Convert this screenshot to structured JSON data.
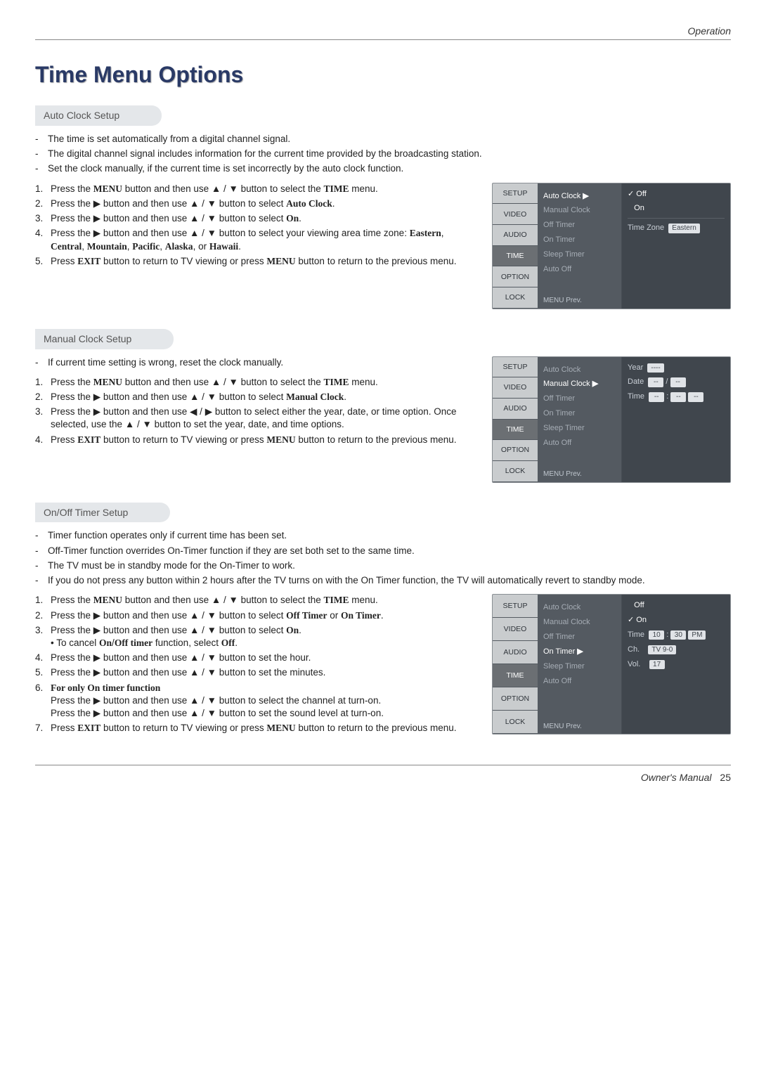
{
  "header_label": "Operation",
  "page_title": "Time Menu Options",
  "footer_label": "Owner's Manual",
  "footer_page": "25",
  "osd_tabs": [
    "SETUP",
    "VIDEO",
    "AUDIO",
    "TIME",
    "OPTION",
    "LOCK"
  ],
  "osd_menu_items": [
    "Auto Clock",
    "Manual Clock",
    "Off Timer",
    "On Timer",
    "Sleep Timer",
    "Auto Off"
  ],
  "osd_prev_hint": "MENU Prev.",
  "auto": {
    "title": "Auto Clock Setup",
    "notes": [
      "The time is set automatically from a digital channel signal.",
      "The digital channel signal includes information for the current time provided by the broadcasting station.",
      "Set the clock manually, if the current time is set incorrectly by the auto clock function."
    ],
    "steps": [
      "Press the <b class='strong'>MENU</b> button and then use <span class='arrow'>▲</span> / <span class='arrow'>▼</span> button to select the <b class='strong'>TIME</b> menu.",
      "Press the <span class='arrow'>▶</span> button and then use <span class='arrow'>▲</span> / <span class='arrow'>▼</span> button to select <b class='strong'>Auto Clock</b>.",
      "Press the <span class='arrow'>▶</span> button and then use <span class='arrow'>▲</span> / <span class='arrow'>▼</span> button to select <b class='strong'>On</b>.",
      "Press the <span class='arrow'>▶</span> button and then use <span class='arrow'>▲</span> / <span class='arrow'>▼</span> button to select your viewing area time zone: <b class='strong'>Eastern</b>, <b class='strong'>Central</b>, <b class='strong'>Mountain</b>, <b class='strong'>Pacific</b>, <b class='strong'>Alaska</b>, or <b class='strong'>Hawaii</b>.",
      "Press <b class='strong'>EXIT</b> button to return to TV viewing or press <b class='strong'>MENU</b> button to return to the previous menu."
    ],
    "osd_right": {
      "l1_tick": "✓",
      "l1_val": "Off",
      "l2_val": "On",
      "l3_label": "Time Zone",
      "l3_val": "Eastern"
    }
  },
  "manual": {
    "title": "Manual Clock Setup",
    "notes": [
      "If current time setting is wrong, reset the clock manually."
    ],
    "steps": [
      "Press the <b class='strong'>MENU</b> button and then use <span class='arrow'>▲</span> / <span class='arrow'>▼</span> button to select the <b class='strong'>TIME</b> menu.",
      "Press the <span class='arrow'>▶</span> button and then use <span class='arrow'>▲</span> / <span class='arrow'>▼</span> button to select <b class='strong'>Manual Clock</b>.",
      "Press the <span class='arrow'>▶</span> button and then use <span class='arrow'>◀</span> / <span class='arrow'>▶</span> button to select either the year, date, or time option. Once selected, use the <span class='arrow'>▲</span> / <span class='arrow'>▼</span> button to set the year, date, and time options.",
      "Press <b class='strong'>EXIT</b> button to return to TV viewing or press <b class='strong'>MENU</b> button to return to the previous menu."
    ],
    "osd_right": {
      "l1_label": "Year",
      "l2_label": "Date",
      "l3_label": "Time"
    }
  },
  "timer": {
    "title": "On/Off Timer Setup",
    "notes": [
      "Timer function operates only if current time has been set.",
      "Off-Timer function overrides On-Timer function if they are set both set to the same time.",
      "The TV must be in standby mode for the On-Timer to work.",
      "If you do not press any button within 2 hours after the TV turns on with the On Timer function, the TV will automatically revert to standby mode."
    ],
    "steps": [
      "Press the <b class='strong'>MENU</b> button and then use <span class='arrow'>▲</span> / <span class='arrow'>▼</span> button to select the <b class='strong'>TIME</b> menu.",
      "Press the <span class='arrow'>▶</span> button and then use <span class='arrow'>▲</span> / <span class='arrow'>▼</span> button to select <b class='strong'>Off Timer</b> or <b class='strong'>On Timer</b>.",
      "Press the <span class='arrow'>▶</span> button and then use <span class='arrow'>▲</span> / <span class='arrow'>▼</span> button to select <b class='strong'>On</b>.<br>• To cancel <b class='strong'>On</b>/<b class='strong'>Off timer</b> function, select <b class='strong'>Off</b>.",
      "Press the <span class='arrow'>▶</span> button and then use <span class='arrow'>▲</span> / <span class='arrow'>▼</span> button to set the hour.",
      "Press the <span class='arrow'>▶</span> button and then use <span class='arrow'>▲</span> / <span class='arrow'>▼</span> button to set the minutes.",
      "<b class='strong'>For only On timer function</b><br>Press the <span class='arrow'>▶</span> button and then use <span class='arrow'>▲</span> / <span class='arrow'>▼</span> button to select the channel at turn-on.<br>Press the <span class='arrow'>▶</span> button and then use <span class='arrow'>▲</span> / <span class='arrow'>▼</span> button to set the sound level at turn-on.",
      "Press <b class='strong'>EXIT</b> button to return to TV viewing or press <b class='strong'>MENU</b> button to return to the previous menu."
    ],
    "osd_right": {
      "l1_val": "Off",
      "l2_tick": "✓",
      "l2_val": "On",
      "l3_label": "Time",
      "l3_h": "10",
      "l3_m": "30",
      "l3_ap": "PM",
      "l4_label": "Ch.",
      "l4_val": "TV 9-0",
      "l5_label": "Vol.",
      "l5_val": "17"
    }
  }
}
